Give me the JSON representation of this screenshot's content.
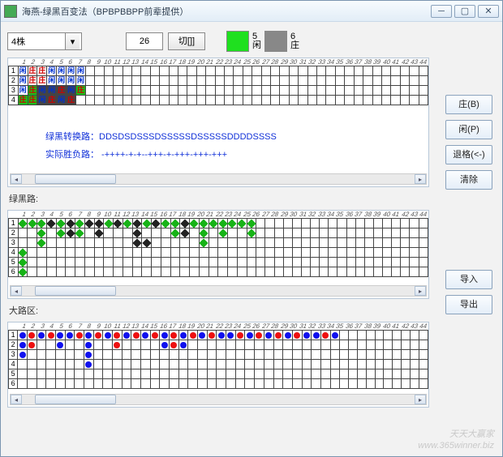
{
  "window": {
    "title": "海燕-绿黑百变法（BPBPBBPP前辈提供）"
  },
  "top": {
    "combo_value": "4株",
    "count": "26",
    "cut_label": "切[]]",
    "swatch1_num": "5",
    "swatch1_lbl": "闲",
    "swatch2_num": "6",
    "swatch2_lbl": "庄"
  },
  "sidebar": {
    "zhuang": "庄(B)",
    "xian": "闲(P)",
    "back": "退格(<-)",
    "clear": "清除",
    "importb": "导入",
    "exportb": "导出"
  },
  "section": {
    "lvhei": "绿黑路:",
    "dalu": "大路区:"
  },
  "text": {
    "line1_label": "绿黑转换路：",
    "line1_val": "DDSDSDSSSDSSSSSDSSSSSDDDDSSSS",
    "line2_label": "实际胜负路：",
    "line2_val": "  -++++-+-+--+++-+-+++-+++-+++"
  },
  "grid1": {
    "cols": 44,
    "rows": 4,
    "cells": [
      [
        {
          "t": "闲",
          "c": "xi"
        },
        {
          "t": "庄",
          "c": "zh"
        },
        {
          "t": "庄",
          "c": "zh"
        },
        {
          "t": "闲",
          "c": "xi"
        },
        {
          "t": "闲",
          "c": "xi"
        },
        {
          "t": "闲",
          "c": "xi"
        },
        {
          "t": "闲",
          "c": "xi"
        }
      ],
      [
        {
          "t": "闲",
          "c": "xi"
        },
        {
          "t": "庄",
          "c": "zh"
        },
        {
          "t": "庄",
          "c": "zh"
        },
        {
          "t": "闲",
          "c": "xi"
        },
        {
          "t": "闲",
          "c": "xi"
        },
        {
          "t": "闲",
          "c": "xi"
        },
        {
          "t": "闲",
          "c": "xi"
        }
      ],
      [
        {
          "t": "闲",
          "c": "xi"
        },
        {
          "t": "庄",
          "c": "zh",
          "bg": "g"
        },
        {
          "t": "闲",
          "c": "xi",
          "bg": "k"
        },
        {
          "t": "闲",
          "c": "xi",
          "bg": "k"
        },
        {
          "t": "庄",
          "c": "zh",
          "bg": "k"
        },
        {
          "t": "闲",
          "c": "xi",
          "bg": "k"
        },
        {
          "t": "庄",
          "c": "zh",
          "bg": "g"
        }
      ],
      [
        {
          "t": "庄",
          "c": "zh",
          "bg": "g"
        },
        {
          "t": "庄",
          "c": "zh",
          "bg": "g"
        },
        {
          "t": "闲",
          "c": "xi",
          "bg": "k"
        },
        {
          "t": "庄",
          "c": "zh",
          "bg": "k"
        },
        {
          "t": "闲",
          "c": "xi",
          "bg": "k"
        },
        {
          "t": "庄",
          "c": "zh",
          "bg": "k"
        }
      ]
    ]
  },
  "grid2": {
    "cols": 44,
    "rows": 6,
    "marks": [
      [
        1,
        1,
        "g"
      ],
      [
        1,
        2,
        "g"
      ],
      [
        1,
        3,
        "g"
      ],
      [
        2,
        3,
        "g"
      ],
      [
        1,
        4,
        "k"
      ],
      [
        1,
        5,
        "g"
      ],
      [
        2,
        5,
        "g"
      ],
      [
        1,
        6,
        "k"
      ],
      [
        1,
        7,
        "g"
      ],
      [
        1,
        8,
        "k"
      ],
      [
        1,
        9,
        "k"
      ],
      [
        2,
        9,
        "k"
      ],
      [
        1,
        10,
        "g"
      ],
      [
        1,
        11,
        "k"
      ],
      [
        1,
        12,
        "g"
      ],
      [
        1,
        13,
        "k"
      ],
      [
        2,
        13,
        "k"
      ],
      [
        3,
        13,
        "k"
      ],
      [
        3,
        14,
        "k"
      ],
      [
        1,
        14,
        "g"
      ],
      [
        1,
        15,
        "k"
      ],
      [
        1,
        16,
        "g"
      ],
      [
        1,
        17,
        "g"
      ],
      [
        2,
        17,
        "g"
      ],
      [
        1,
        18,
        "k"
      ],
      [
        2,
        18,
        "k"
      ],
      [
        1,
        19,
        "g"
      ],
      [
        1,
        20,
        "g"
      ],
      [
        2,
        20,
        "g"
      ],
      [
        3,
        20,
        "g"
      ],
      [
        1,
        21,
        "g"
      ],
      [
        1,
        22,
        "g"
      ],
      [
        2,
        22,
        "g"
      ],
      [
        1,
        23,
        "g"
      ],
      [
        1,
        24,
        "g"
      ],
      [
        1,
        25,
        "g"
      ],
      [
        2,
        25,
        "g"
      ],
      [
        4,
        1,
        "g"
      ],
      [
        5,
        1,
        "g"
      ],
      [
        6,
        1,
        "g"
      ],
      [
        3,
        3,
        "g"
      ],
      [
        2,
        6,
        "k"
      ],
      [
        2,
        7,
        "g"
      ]
    ]
  },
  "grid3": {
    "cols": 44,
    "rows": 6,
    "marks": [
      [
        1,
        1,
        "b"
      ],
      [
        2,
        1,
        "b"
      ],
      [
        3,
        1,
        "b"
      ],
      [
        1,
        2,
        "r"
      ],
      [
        2,
        2,
        "r"
      ],
      [
        1,
        3,
        "b"
      ],
      [
        1,
        4,
        "r"
      ],
      [
        1,
        5,
        "b"
      ],
      [
        2,
        5,
        "b"
      ],
      [
        1,
        6,
        "b"
      ],
      [
        1,
        7,
        "r"
      ],
      [
        1,
        8,
        "b"
      ],
      [
        2,
        8,
        "b"
      ],
      [
        3,
        8,
        "b"
      ],
      [
        4,
        8,
        "b"
      ],
      [
        1,
        9,
        "r"
      ],
      [
        1,
        10,
        "b"
      ],
      [
        1,
        11,
        "r"
      ],
      [
        2,
        11,
        "r"
      ],
      [
        1,
        12,
        "b"
      ],
      [
        1,
        13,
        "r"
      ],
      [
        1,
        14,
        "b"
      ],
      [
        1,
        15,
        "r"
      ],
      [
        1,
        16,
        "b"
      ],
      [
        2,
        16,
        "b"
      ],
      [
        1,
        17,
        "r"
      ],
      [
        2,
        17,
        "r"
      ],
      [
        1,
        18,
        "b"
      ],
      [
        2,
        18,
        "b"
      ],
      [
        1,
        19,
        "r"
      ],
      [
        1,
        20,
        "b"
      ],
      [
        1,
        21,
        "r"
      ],
      [
        1,
        22,
        "b"
      ],
      [
        1,
        23,
        "b"
      ],
      [
        1,
        24,
        "r"
      ],
      [
        1,
        25,
        "b"
      ],
      [
        1,
        26,
        "r"
      ],
      [
        1,
        27,
        "b"
      ],
      [
        1,
        28,
        "r"
      ],
      [
        1,
        29,
        "b"
      ],
      [
        1,
        30,
        "r"
      ],
      [
        1,
        31,
        "b"
      ],
      [
        1,
        32,
        "b"
      ],
      [
        1,
        33,
        "r"
      ],
      [
        1,
        34,
        "b"
      ]
    ]
  },
  "watermark": {
    "l1": "天天大赢家",
    "l2": "www.365winner.biz"
  }
}
